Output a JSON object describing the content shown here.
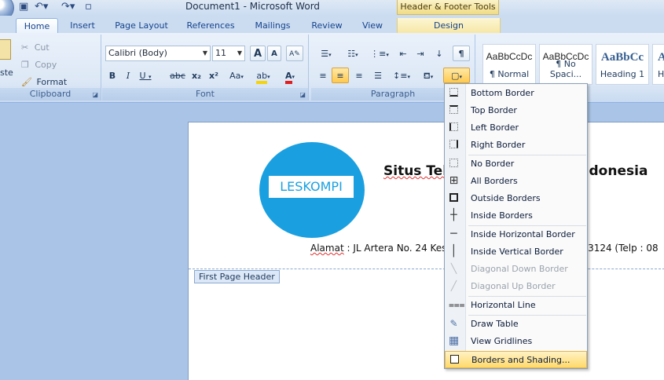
{
  "window": {
    "title": "Document1 - Microsoft Word",
    "contextual_group": "Header & Footer Tools"
  },
  "tabs": [
    {
      "label": "Home"
    },
    {
      "label": "Insert"
    },
    {
      "label": "Page Layout"
    },
    {
      "label": "References"
    },
    {
      "label": "Mailings"
    },
    {
      "label": "Review"
    },
    {
      "label": "View"
    },
    {
      "label": "Design"
    }
  ],
  "ribbon": {
    "clipboard": {
      "paste_partial": "ste",
      "cut": "Cut",
      "copy": "Copy",
      "format_painter": "Format Painter",
      "label": "Clipboard"
    },
    "font": {
      "font_name": "Calibri (Body)",
      "font_size": "11",
      "bold": "B",
      "italic": "I",
      "underline": "U",
      "strikethrough": "abc",
      "subscript": "x₂",
      "superscript": "x²",
      "aa": "Aa",
      "grow": "A",
      "shrink": "A",
      "label": "Font"
    },
    "paragraph": {
      "label": "Paragraph"
    },
    "styles": [
      {
        "sample": "AaBbCcDc",
        "name": "¶ Normal"
      },
      {
        "sample": "AaBbCcDc",
        "name": "¶ No Spaci..."
      },
      {
        "sample": "AaBbCc",
        "name": "Heading 1"
      },
      {
        "sample": "A",
        "name": "H"
      }
    ]
  },
  "document": {
    "logo_text": "LESKOMPI",
    "site_name_start": "Situs Tek",
    "site_name_end": "donesia",
    "address_label": "Alamat",
    "address_start": " : JL Artera No. 24 Kes",
    "address_end": "43124 (Telp : 08",
    "header_tag": "First Page Header"
  },
  "borders_menu": {
    "items": [
      {
        "label": "Bottom Border",
        "icon": "bottom-border-icon",
        "enabled": true
      },
      {
        "label": "Top Border",
        "icon": "top-border-icon",
        "enabled": true
      },
      {
        "label": "Left Border",
        "icon": "left-border-icon",
        "enabled": true
      },
      {
        "label": "Right Border",
        "icon": "right-border-icon",
        "enabled": true
      },
      {
        "label": "No Border",
        "icon": "no-border-icon",
        "enabled": true
      },
      {
        "label": "All Borders",
        "icon": "all-borders-icon",
        "enabled": true
      },
      {
        "label": "Outside Borders",
        "icon": "outside-borders-icon",
        "enabled": true
      },
      {
        "label": "Inside Borders",
        "icon": "inside-borders-icon",
        "enabled": true
      },
      {
        "label": "Inside Horizontal Border",
        "icon": "inside-horizontal-border-icon",
        "enabled": true
      },
      {
        "label": "Inside Vertical Border",
        "icon": "inside-vertical-border-icon",
        "enabled": true
      },
      {
        "label": "Diagonal Down Border",
        "icon": "diagonal-down-border-icon",
        "enabled": false
      },
      {
        "label": "Diagonal Up Border",
        "icon": "diagonal-up-border-icon",
        "enabled": false
      },
      {
        "label": "Horizontal Line",
        "icon": "horizontal-line-icon",
        "enabled": true
      },
      {
        "label": "Draw Table",
        "icon": "draw-table-icon",
        "enabled": true
      },
      {
        "label": "View Gridlines",
        "icon": "view-gridlines-icon",
        "enabled": true
      },
      {
        "label": "Borders and Shading...",
        "icon": "borders-shading-icon",
        "enabled": true,
        "highlighted": true
      }
    ]
  },
  "colors": {
    "logo_blue": "#1aa0e0",
    "ribbon_blue": "#dde8f6",
    "menu_highlight": "#ffd96b",
    "highlight_yellow": "#f5d40f",
    "font_red": "#e02020"
  }
}
